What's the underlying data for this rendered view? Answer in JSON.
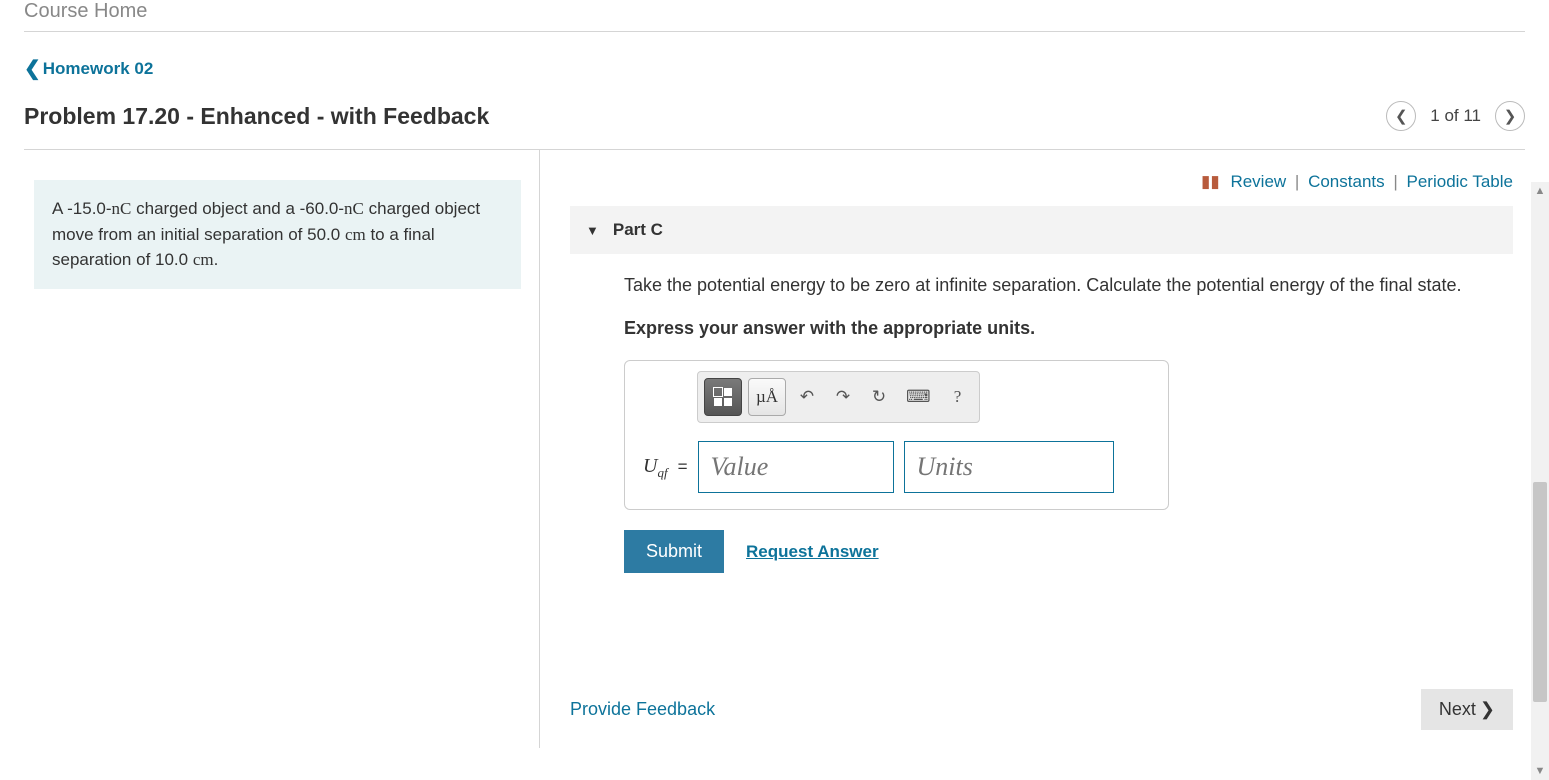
{
  "course_home": "Course Home",
  "back_link": "Homework 02",
  "problem_title": "Problem 17.20 - Enhanced - with Feedback",
  "pager": {
    "text": "1 of 11"
  },
  "problem_statement": {
    "p1_a": "A -15.0-",
    "p1_b": "nC",
    "p1_c": " charged object and a -60.0-",
    "p1_d": "nC",
    "p1_e": " charged object move from an initial separation of 50.0 ",
    "p1_f": "cm",
    "p1_g": " to a final separation of 10.0 ",
    "p1_h": "cm",
    "p1_i": "."
  },
  "top_links": {
    "review": "Review",
    "constants": "Constants",
    "periodic": "Periodic Table"
  },
  "part": {
    "label": "Part C",
    "instruction": "Take the potential energy to be zero at infinite separation. Calculate the potential energy of the final state.",
    "units_instruction": "Express your answer with the appropriate units."
  },
  "toolbar": {
    "templates": "templates-tool",
    "units_symbol": "µÅ",
    "help": "?"
  },
  "answer": {
    "var_main": "U",
    "var_sub": "qf",
    "eq": "=",
    "value_placeholder": "Value",
    "units_placeholder": "Units"
  },
  "buttons": {
    "submit": "Submit",
    "request": "Request Answer",
    "provide_feedback": "Provide Feedback",
    "next": "Next"
  }
}
